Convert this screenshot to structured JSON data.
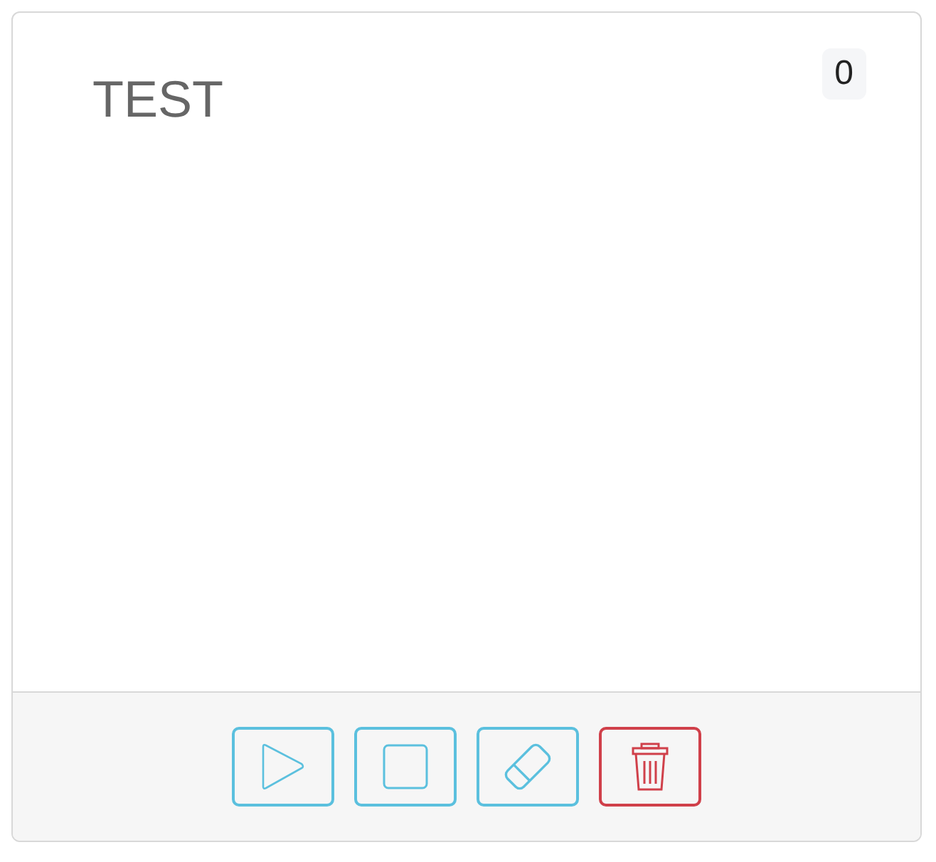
{
  "card": {
    "title": "TEST",
    "count": "0"
  },
  "actions": [
    {
      "kind": "play"
    },
    {
      "kind": "stop"
    },
    {
      "kind": "clear"
    },
    {
      "kind": "delete"
    }
  ]
}
